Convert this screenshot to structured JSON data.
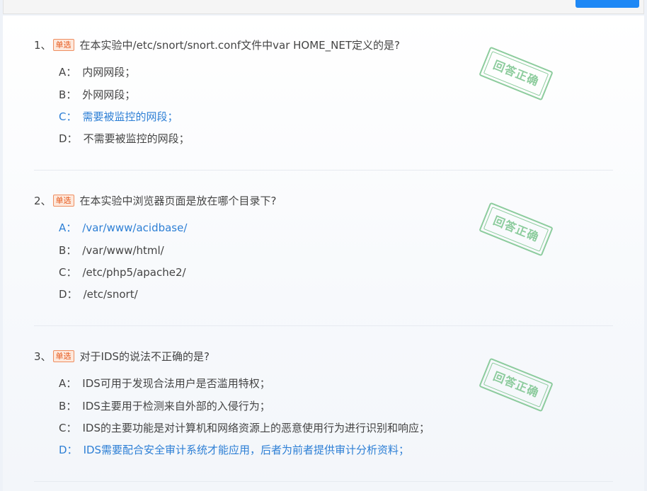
{
  "questions": [
    {
      "number": "1、",
      "type_badge": "单选",
      "text": "在本实验中/etc/snort/snort.conf文件中var HOME_NET定义的是?",
      "stamp": "回答正确",
      "options": [
        {
          "letter": "A：",
          "text": "内网网段；",
          "correct": false
        },
        {
          "letter": "B：",
          "text": "外网网段；",
          "correct": false
        },
        {
          "letter": "C：",
          "text": "需要被监控的网段；",
          "correct": true
        },
        {
          "letter": "D：",
          "text": "不需要被监控的网段；",
          "correct": false
        }
      ]
    },
    {
      "number": "2、",
      "type_badge": "单选",
      "text": "在本实验中浏览器页面是放在哪个目录下?",
      "stamp": "回答正确",
      "options": [
        {
          "letter": "A：",
          "text": "/var/www/acidbase/",
          "correct": true
        },
        {
          "letter": "B：",
          "text": "/var/www/html/",
          "correct": false
        },
        {
          "letter": "C：",
          "text": "/etc/php5/apache2/",
          "correct": false
        },
        {
          "letter": "D：",
          "text": "/etc/snort/",
          "correct": false
        }
      ]
    },
    {
      "number": "3、",
      "type_badge": "单选",
      "text": "对于IDS的说法不正确的是?",
      "stamp": "回答正确",
      "options": [
        {
          "letter": "A：",
          "text": "IDS可用于发现合法用户是否滥用特权；",
          "correct": false
        },
        {
          "letter": "B：",
          "text": "IDS主要用于检测来自外部的入侵行为；",
          "correct": false
        },
        {
          "letter": "C：",
          "text": "IDS的主要功能是对计算机和网络资源上的恶意使用行为进行识别和响应；",
          "correct": false
        },
        {
          "letter": "D：",
          "text": "IDS需要配合安全审计系统才能应用，后者为前者提供审计分析资料；",
          "correct": true
        }
      ]
    }
  ]
}
